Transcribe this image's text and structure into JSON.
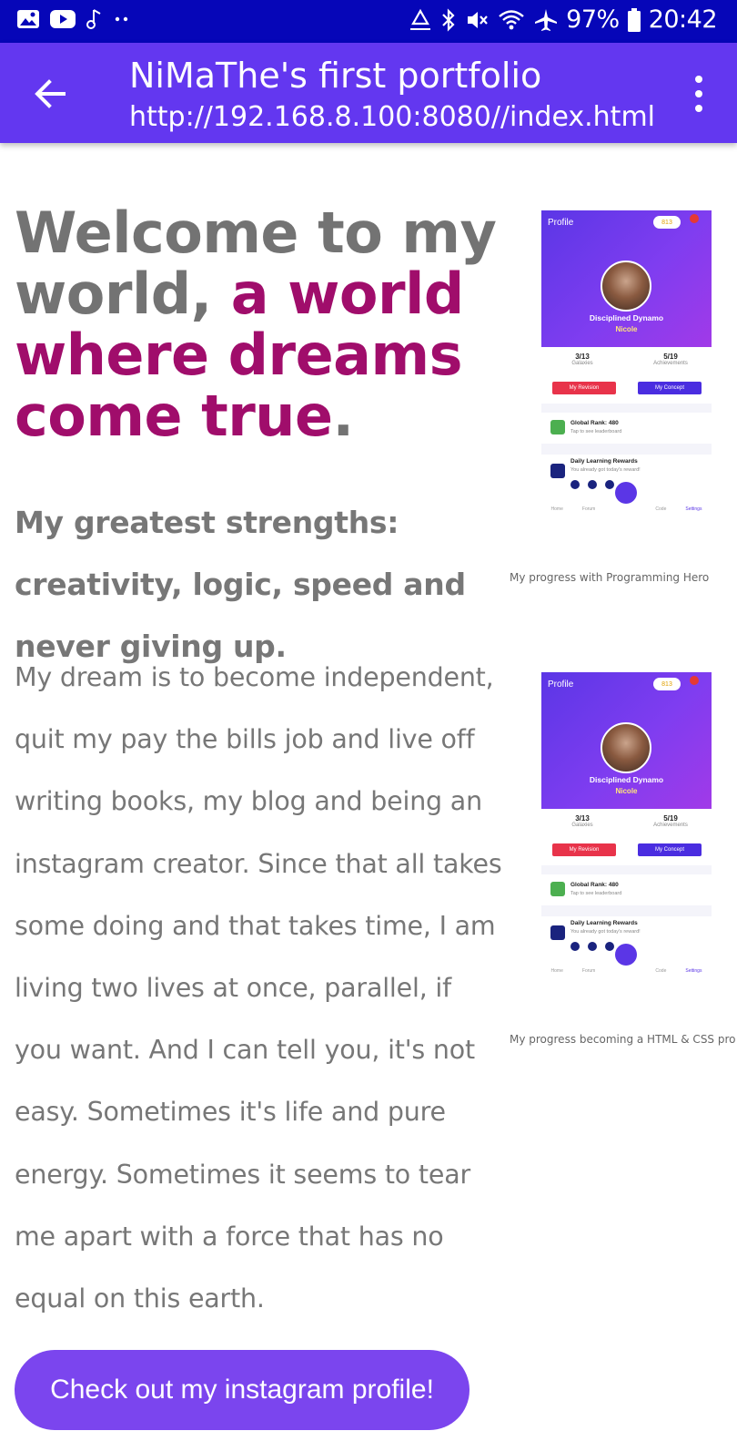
{
  "status_bar": {
    "battery": "97%",
    "time": "20:42",
    "left_icons": [
      "image-icon",
      "youtube-icon",
      "music-note-icon",
      "more-dots-icon"
    ],
    "right_icons": [
      "recycle-icon",
      "bluetooth-icon",
      "mute-icon",
      "wifi-icon",
      "airplane-icon",
      "battery-icon"
    ]
  },
  "app_bar": {
    "title": "NiMaThe's first portfolio",
    "url": "http://192.168.8.100:8080//index.html",
    "back_icon": "arrow-left-icon",
    "menu_icon": "more-vertical-icon"
  },
  "hero": {
    "headline_plain_1": "Welcome to my world, ",
    "headline_highlight": "a world where dreams come true",
    "headline_end": "."
  },
  "strengths": "My greatest strengths: creativity, logic, speed and never giving up.",
  "story": "My dream is to become independent, quit my pay the bills job and live off writing books, my blog and being an instagram creator. Since that all takes some doing and that takes time, I am living two lives at once, parallel, if you want. And I can tell you, it's not easy. Sometimes it's life and pure energy. Sometimes it seems to tear me apart with a force that has no equal on this earth.",
  "cta_label": "Check out my instagram profile!",
  "figures": [
    {
      "caption": "My progress with Programming Hero",
      "screen": {
        "header": "Profile",
        "gems": "813",
        "title": "Disciplined Dynamo",
        "user": "Nicole",
        "galaxies": "3/13",
        "galaxies_label": "Galaxies",
        "achievements": "5/19",
        "achievements_label": "Achievements",
        "revision": "My Revision",
        "concept": "My Concept",
        "rank_title": "Global Rank: 480",
        "rank_sub": "Tap to see leaderboard",
        "reward_title": "Daily Learning Rewards",
        "reward_sub": "You already got today's reward!",
        "nav": [
          "Home",
          "Forum",
          "Code",
          "Settings"
        ]
      }
    },
    {
      "caption": "My progress becoming a HTML & CSS pro",
      "screen": {
        "header": "Profile",
        "gems": "813",
        "title": "Disciplined Dynamo",
        "user": "Nicole",
        "galaxies": "3/13",
        "galaxies_label": "Galaxies",
        "achievements": "5/19",
        "achievements_label": "Achievements",
        "revision": "My Revision",
        "concept": "My Concept",
        "rank_title": "Global Rank: 480",
        "rank_sub": "Tap to see leaderboard",
        "reward_title": "Daily Learning Rewards",
        "reward_sub": "You already got today's reward!",
        "nav": [
          "Home",
          "Forum",
          "Code",
          "Settings"
        ]
      }
    }
  ],
  "colors": {
    "status_bar": "#0606b8",
    "app_bar": "#6337f0",
    "highlight": "#a00d6b",
    "button": "#7b45ee",
    "text": "#777777"
  }
}
